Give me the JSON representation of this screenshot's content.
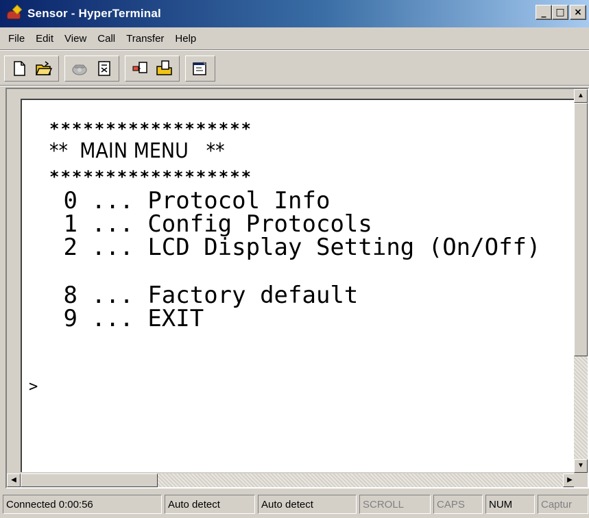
{
  "window": {
    "title": "Sensor - HyperTerminal",
    "controls": {
      "minimize": "_",
      "maximize": "□",
      "close": "×"
    }
  },
  "menubar": [
    "File",
    "Edit",
    "View",
    "Call",
    "Transfer",
    "Help"
  ],
  "toolbar": {
    "buttons": [
      "new-icon",
      "open-icon",
      "call-icon",
      "disconnect-icon",
      "send-icon",
      "receive-icon",
      "properties-icon"
    ]
  },
  "terminal": {
    "stars_top": "******************",
    "title": "**  MAIN MENU   **",
    "stars_bottom": "******************",
    "options": [
      {
        "key": "0",
        "label": "... Protocol Info"
      },
      {
        "key": "1",
        "label": "... Config Protocols"
      },
      {
        "key": "2",
        "label": "... LCD Display Setting (On/Off)"
      },
      {
        "key": "8",
        "label": "... Factory default"
      },
      {
        "key": "9",
        "label": "... EXIT"
      }
    ],
    "prompt": ">"
  },
  "statusbar": {
    "connected": "Connected 0:00:56",
    "emulation": "Auto detect",
    "settings": "Auto detect",
    "scroll": "SCROLL",
    "caps": "CAPS",
    "num": "NUM",
    "capture": "Captur"
  }
}
